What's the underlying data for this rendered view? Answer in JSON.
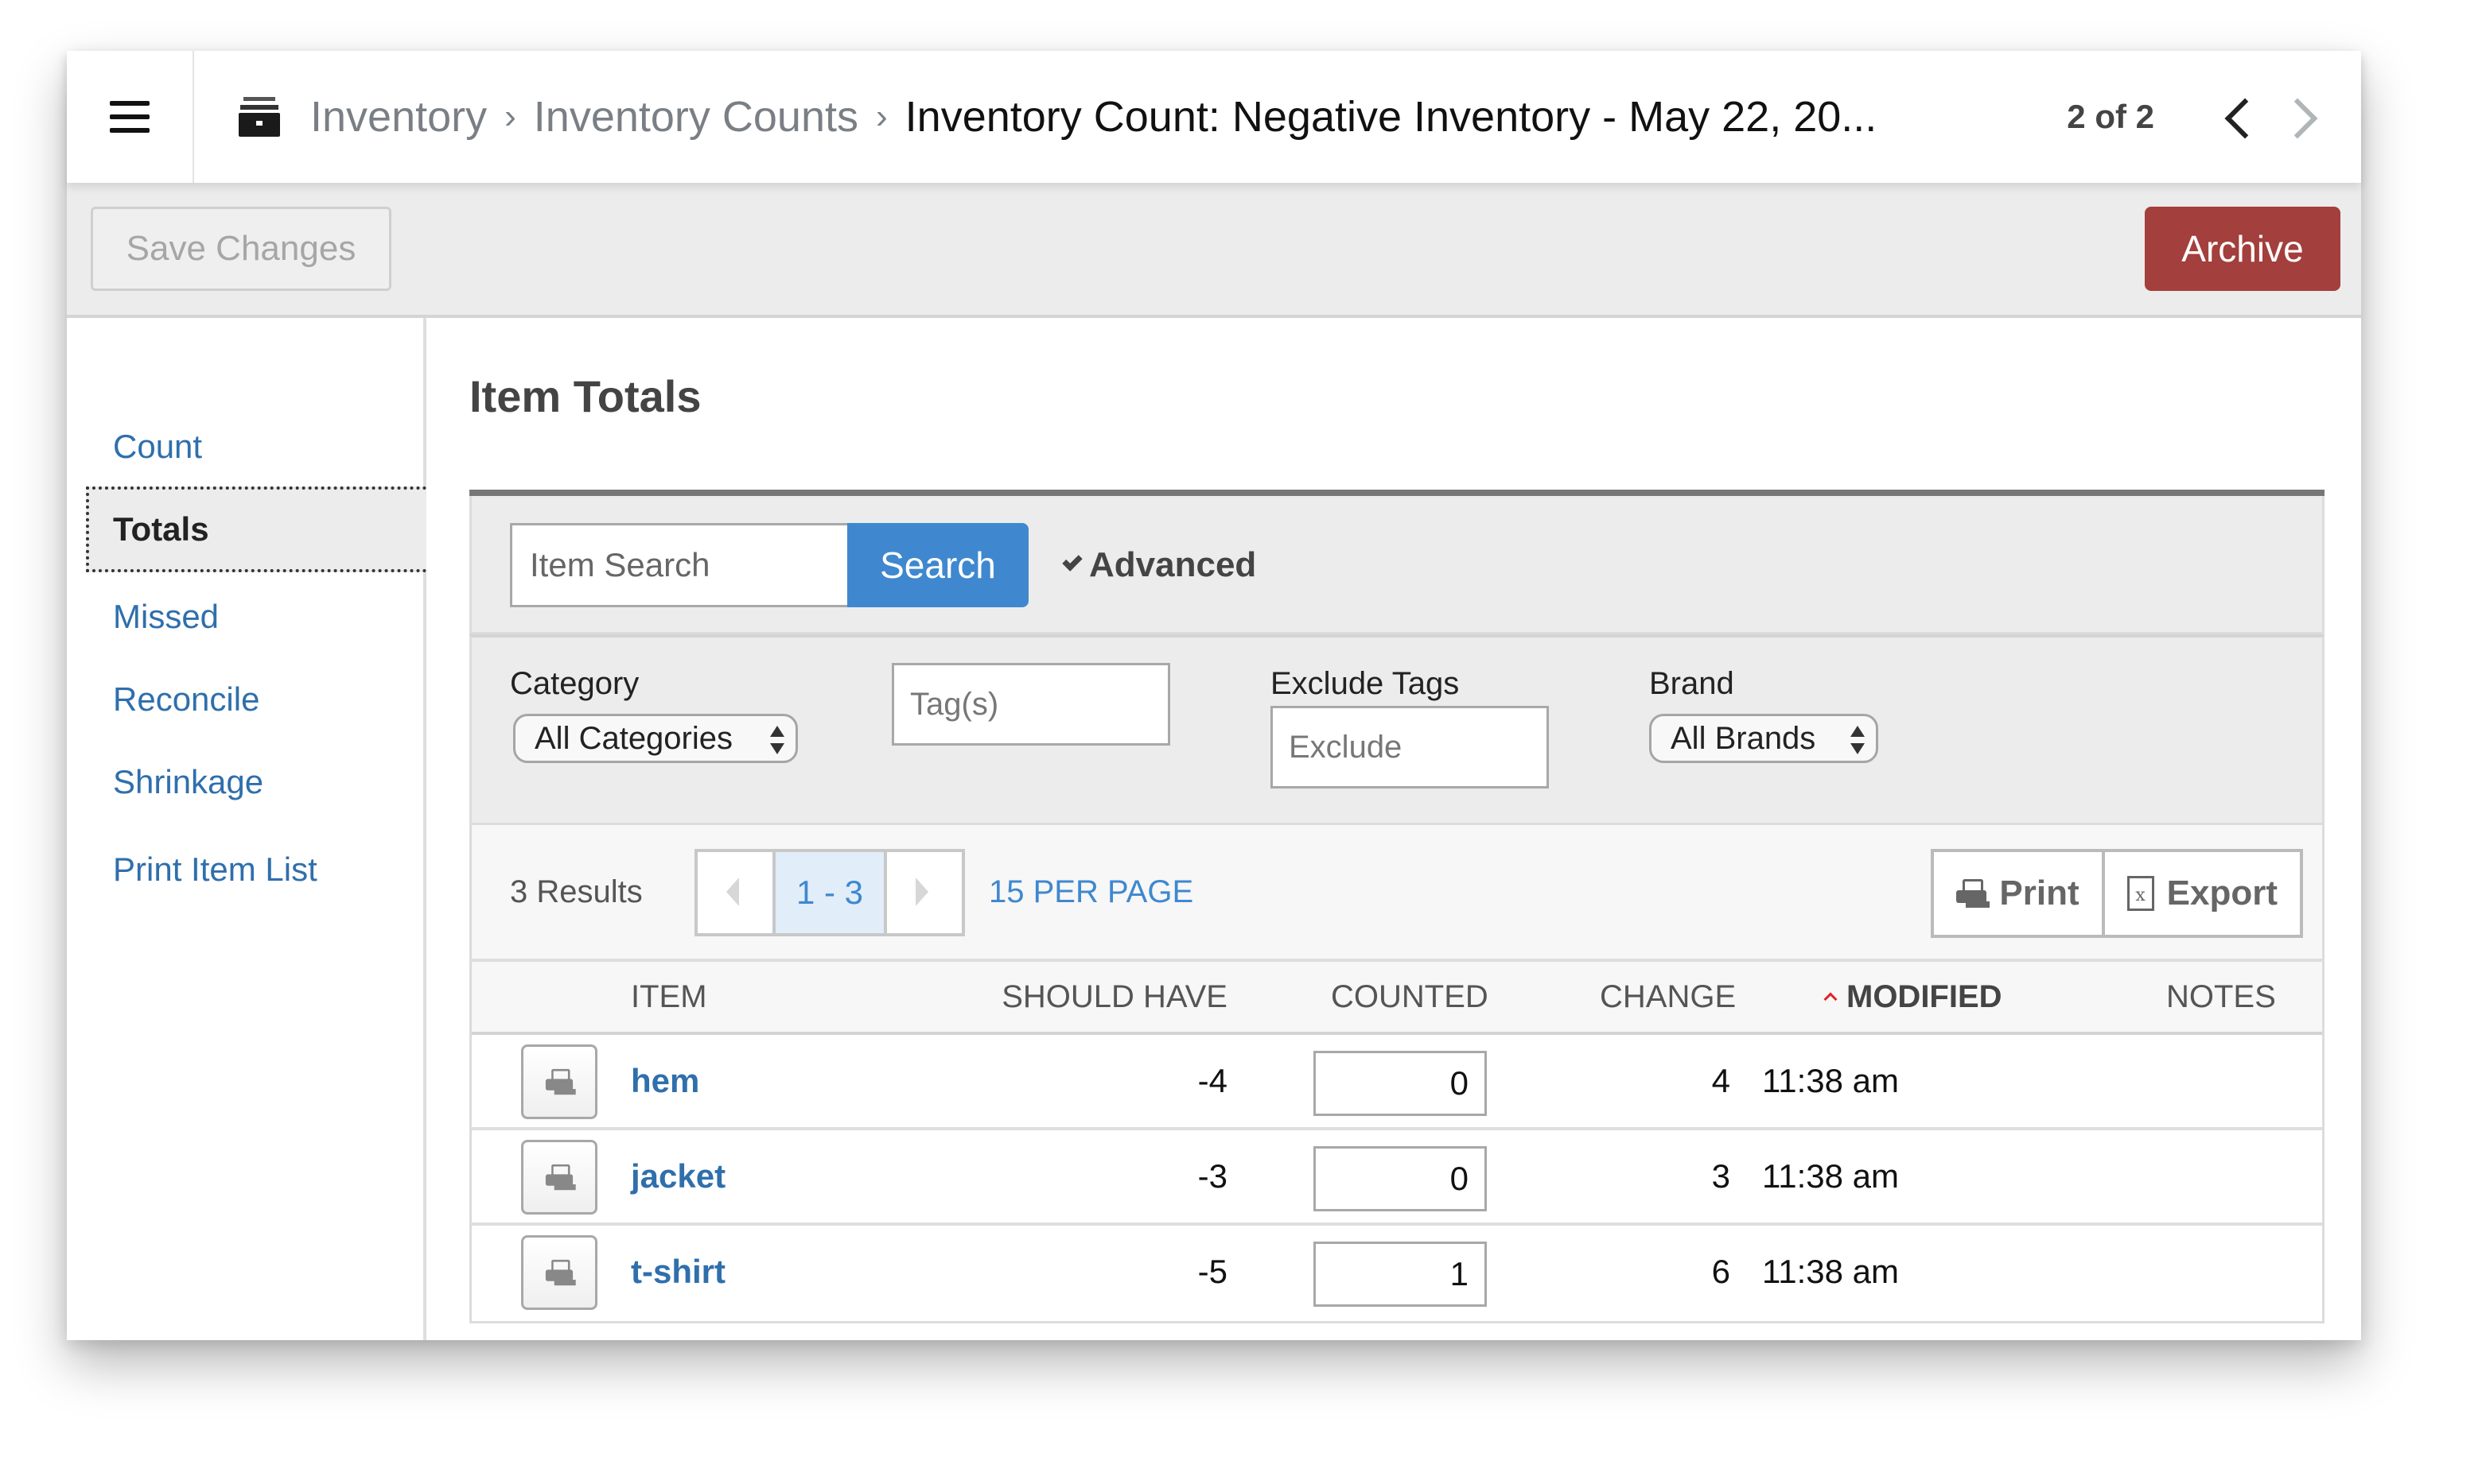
{
  "header": {
    "menu_icon": "hamburger-menu-icon",
    "breadcrumb_icon": "archive-box-icon",
    "breadcrumb": [
      {
        "label": "Inventory"
      },
      {
        "label": "Inventory Counts"
      }
    ],
    "separator": "›",
    "current": "Inventory Count: Negative Inventory - May 22, 20...",
    "record_position": "2 of 2",
    "prev_icon": "chevron-left-icon",
    "next_icon": "chevron-right-icon"
  },
  "toolbar": {
    "save_label": "Save Changes",
    "archive_label": "Archive",
    "archive_color": "#a33f3c"
  },
  "sidebar": {
    "items": [
      {
        "label": "Count",
        "active": false
      },
      {
        "label": "Totals",
        "active": true
      },
      {
        "label": "Missed",
        "active": false
      },
      {
        "label": "Reconcile",
        "active": false
      },
      {
        "label": "Shrinkage",
        "active": false
      },
      {
        "label": "Print Item List",
        "active": false
      }
    ]
  },
  "main": {
    "title": "Item Totals",
    "search": {
      "placeholder": "Item Search",
      "value": "",
      "button_label": "Search",
      "advanced_label": "Advanced"
    },
    "filters": {
      "category_label": "Category",
      "category_value": "All Categories",
      "tags_placeholder": "Tag(s)",
      "exclude_label": "Exclude Tags",
      "exclude_placeholder": "Exclude",
      "brand_label": "Brand",
      "brand_value": "All Brands"
    },
    "results": {
      "count_text": "3 Results",
      "page_range": "1 - 3",
      "per_page": "15 PER PAGE",
      "print_label": "Print",
      "export_label": "Export"
    },
    "table": {
      "columns": [
        "ITEM",
        "SHOULD HAVE",
        "COUNTED",
        "CHANGE",
        "MODIFIED",
        "NOTES"
      ],
      "sorted_column": "MODIFIED",
      "sort_direction": "ascending",
      "rows": [
        {
          "item": "hem",
          "should_have": "-4",
          "counted": "0",
          "change": "4",
          "modified": "11:38 am",
          "notes": ""
        },
        {
          "item": "jacket",
          "should_have": "-3",
          "counted": "0",
          "change": "3",
          "modified": "11:38 am",
          "notes": ""
        },
        {
          "item": "t-shirt",
          "should_have": "-5",
          "counted": "1",
          "change": "6",
          "modified": "11:38 am",
          "notes": ""
        }
      ]
    }
  },
  "colors": {
    "link": "#2f6fac",
    "primary": "#3f88cf",
    "danger": "#a33f3c",
    "sort_indicator": "#e0222a"
  }
}
